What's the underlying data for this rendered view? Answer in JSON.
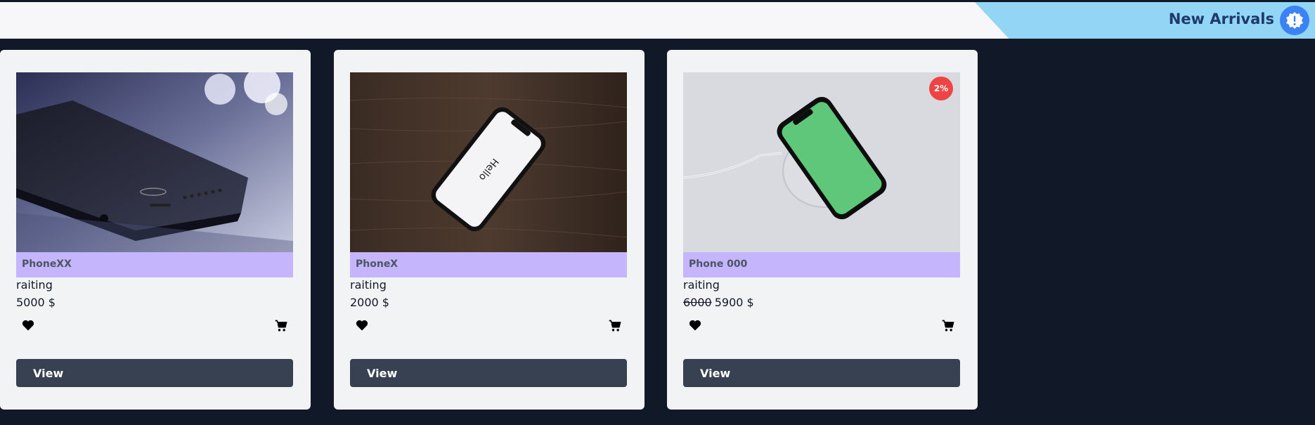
{
  "banner": {
    "title": "New Arrivals",
    "icon": "alert-badge-icon"
  },
  "products": [
    {
      "name": "PhoneXX",
      "rating_label": "raiting",
      "price": "5000 $",
      "old_price": "",
      "discount": "",
      "view_label": "View",
      "image_icon": "phone-photo-dark"
    },
    {
      "name": "PhoneX",
      "rating_label": "raiting",
      "price": "2000 $",
      "old_price": "",
      "discount": "",
      "view_label": "View",
      "image_icon": "phone-photo-wood",
      "screen_text": "Hello"
    },
    {
      "name": "Phone 000",
      "rating_label": "raiting",
      "price": "5900 $",
      "old_price": "6000",
      "discount": "2%",
      "view_label": "View",
      "image_icon": "phone-photo-green"
    }
  ],
  "colors": {
    "page_bg": "#111827",
    "card_bg": "#f2f3f5",
    "name_bar": "#c4b5fd",
    "button": "#374151",
    "discount": "#ef4444",
    "banner_accent": "#93d5f5"
  }
}
